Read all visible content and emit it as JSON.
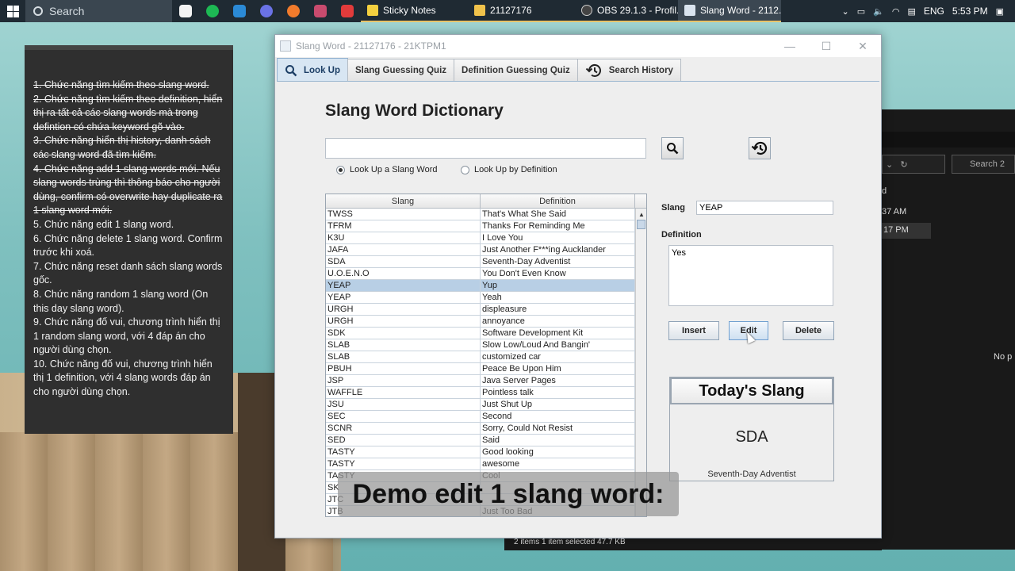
{
  "taskbar": {
    "search_label": "Search",
    "apps": [
      {
        "label": "Sticky Notes",
        "color": "#f4d03f"
      },
      {
        "label": "21127176",
        "color": "#f0c24b"
      },
      {
        "label": "OBS 29.1.3 - Profil...",
        "color": "#444444"
      },
      {
        "label": "Slang Word - 2112...",
        "color": "#d9e3ee"
      }
    ],
    "lang": "ENG",
    "time": "5:53 PM"
  },
  "sticky_note": {
    "lines": [
      {
        "text": "1. Chức năng tìm kiếm theo slang word.",
        "done": true
      },
      {
        "text": "2. Chức năng tìm kiếm theo definition, hiển thị ra tất cả các slang words mà trong defintion có chứa keyword gõ vào.",
        "done": true
      },
      {
        "text": "3. Chức năng hiển thị history, danh sách các slang word đã tìm kiếm.",
        "done": true
      },
      {
        "text": "4. Chức năng add 1 slang words mới. Nếu slang words trùng thì thông báo cho người dùng, confirm có overwrite hay duplicate ra 1 slang word mới.",
        "done": true
      },
      {
        "text": "5. Chức năng edit 1 slang word.",
        "done": false
      },
      {
        "text": "6. Chức năng delete 1 slang word. Confirm trước khi xoá.",
        "done": false
      },
      {
        "text": "7. Chức năng reset danh sách slang words gốc.",
        "done": false
      },
      {
        "text": "8. Chức năng random 1 slang word (On this day slang word).",
        "done": false
      },
      {
        "text": "9. Chức năng đố vui, chương trình hiển thị 1 random slang word, với 4 đáp án cho người dùng chọn.",
        "done": false
      },
      {
        "text": "10. Chức năng đố vui, chương trình hiển thị 1 definition, với 4 slang words đáp án cho người dùng chọn.",
        "done": false
      }
    ]
  },
  "explorer": {
    "search_placeholder": "Search 2",
    "row1": "d",
    "row2": "37 AM",
    "row3": "17 PM",
    "preview": "No p",
    "status": "2 items    1 item selected  47.7 KB"
  },
  "window": {
    "title": "Slang Word - 21127176 - 21KTPM1",
    "tabs": [
      "Look Up",
      "Slang Guessing Quiz",
      "Definition Guessing Quiz",
      "Search History"
    ],
    "heading": "Slang Word Dictionary",
    "search_value": "",
    "radio_slang": "Look Up a Slang Word",
    "radio_def": "Look Up by Definition",
    "table": {
      "headers": [
        "Slang",
        "Definition"
      ],
      "rows": [
        [
          "TWSS",
          "That's What She Said"
        ],
        [
          "TFRM",
          "Thanks For Reminding Me"
        ],
        [
          "K3U",
          "I Love You"
        ],
        [
          "JAFA",
          "Just Another F***ing Aucklander"
        ],
        [
          "SDA",
          "Seventh-Day Adventist"
        ],
        [
          "U.O.E.N.O",
          "You Don't Even Know"
        ],
        [
          "YEAP",
          "Yup"
        ],
        [
          "YEAP",
          "Yeah"
        ],
        [
          "URGH",
          "displeasure"
        ],
        [
          "URGH",
          "annoyance"
        ],
        [
          "SDK",
          "Software Development Kit"
        ],
        [
          "SLAB",
          "Slow Low/Loud And Bangin'"
        ],
        [
          "SLAB",
          "customized car"
        ],
        [
          "PBUH",
          "Peace Be Upon Him"
        ],
        [
          "JSP",
          "Java Server Pages"
        ],
        [
          "WAFFLE",
          "Pointless talk"
        ],
        [
          "JSU",
          "Just Shut Up"
        ],
        [
          "SEC",
          "Second"
        ],
        [
          "SCNR",
          "Sorry, Could Not Resist"
        ],
        [
          "SED",
          "Said"
        ],
        [
          "TASTY",
          "Good looking"
        ],
        [
          "TASTY",
          "awesome"
        ],
        [
          "TASTY",
          "Cool"
        ],
        [
          "SK",
          ""
        ],
        [
          "JTC",
          ""
        ],
        [
          "JTB",
          "Just Too Bad"
        ]
      ],
      "selected_row": 6
    },
    "slang_label": "Slang",
    "slang_value": "YEAP",
    "definition_label": "Definition",
    "definition_value": "Yes",
    "buttons": {
      "insert": "Insert",
      "edit": "Edit",
      "delete": "Delete"
    },
    "today": {
      "title": "Today's Slang",
      "word": "SDA",
      "definition": "Seventh-Day Adventist"
    }
  },
  "caption": "Demo edit 1 slang word:"
}
